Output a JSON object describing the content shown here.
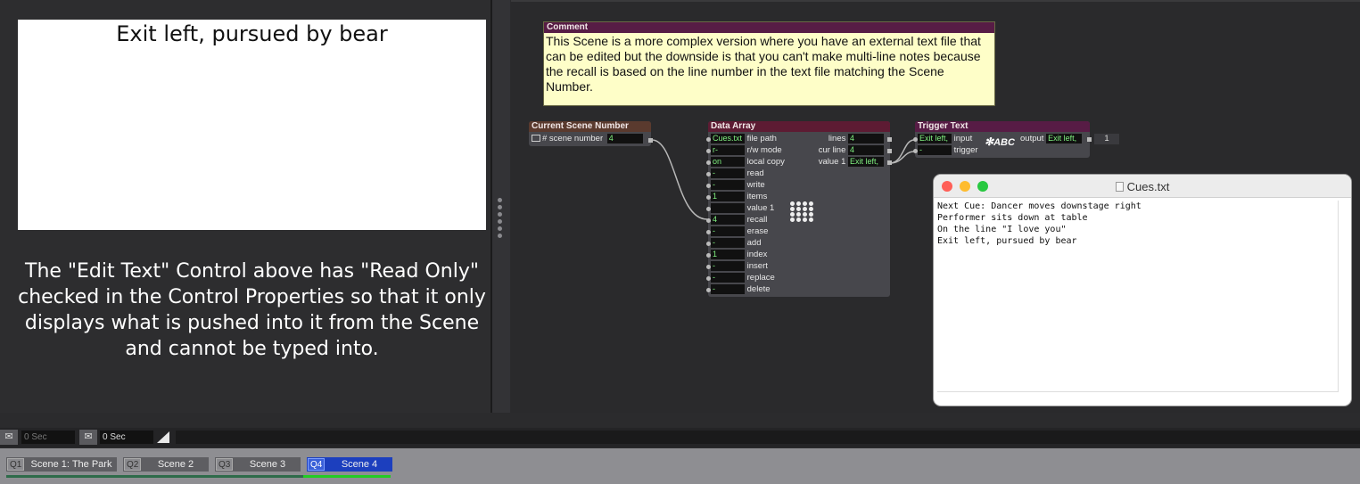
{
  "stage": {
    "edit_text_value": "Exit left, pursued by bear",
    "note": "The \"Edit Text\" Control above has \"Read Only\" checked in the Control Properties so that it only displays what is pushed into it from the Scene and cannot be typed into."
  },
  "comment": {
    "title": "Comment",
    "body": "This Scene is a more complex version where you have an external text file that can be edited but the downside is that you can't make multi-line notes because the recall is based on the line number in the text file matching the Scene Number."
  },
  "current_scene": {
    "title": "Current Scene Number",
    "label": "# scene number",
    "value": "4"
  },
  "data_array": {
    "title": "Data Array",
    "inputs": [
      {
        "value": "Cues.txt",
        "label": "file path"
      },
      {
        "value": "r-",
        "label": "r/w mode"
      },
      {
        "value": "on",
        "label": "local copy"
      },
      {
        "value": "-",
        "label": "read"
      },
      {
        "value": "-",
        "label": "write"
      },
      {
        "value": "1",
        "label": "items"
      },
      {
        "value": "",
        "label": "value 1"
      },
      {
        "value": "4",
        "label": "recall"
      },
      {
        "value": "-",
        "label": "erase"
      },
      {
        "value": "-",
        "label": "add"
      },
      {
        "value": "1",
        "label": "index"
      },
      {
        "value": "-",
        "label": "insert"
      },
      {
        "value": "-",
        "label": "replace"
      },
      {
        "value": "-",
        "label": "delete"
      }
    ],
    "outputs": [
      {
        "label": "lines",
        "value": "4"
      },
      {
        "label": "cur line",
        "value": "4"
      },
      {
        "label": "value 1",
        "value": "Exit left,"
      }
    ]
  },
  "trigger_text": {
    "title": "Trigger Text",
    "input_value": "Exit left,",
    "input_label": "input",
    "trigger_value": "-",
    "trigger_label": "trigger",
    "icon_text": "ABC",
    "output_label": "output",
    "output_value": "Exit left,",
    "downstream_value": "1"
  },
  "cues_window": {
    "title": "Cues.txt",
    "lines": [
      "Next Cue: Dancer moves downstage right",
      "Performer sits down at table",
      "On the line \"I love you\"",
      "Exit left, pursued by bear"
    ]
  },
  "timebar": {
    "fade_in": "0 Sec",
    "fade_out": "0 Sec"
  },
  "scenes": [
    {
      "q": "Q1",
      "name": "Scene 1: The Park"
    },
    {
      "q": "Q2",
      "name": "Scene 2"
    },
    {
      "q": "Q3",
      "name": "Scene 3"
    },
    {
      "q": "Q4",
      "name": "Scene 4",
      "active": true
    }
  ],
  "colors": {
    "active_scene": "#1c3fbe",
    "progress_active": "#22cc22",
    "progress_inactive": "#2e6b4a",
    "value_text": "#7ff07f"
  }
}
